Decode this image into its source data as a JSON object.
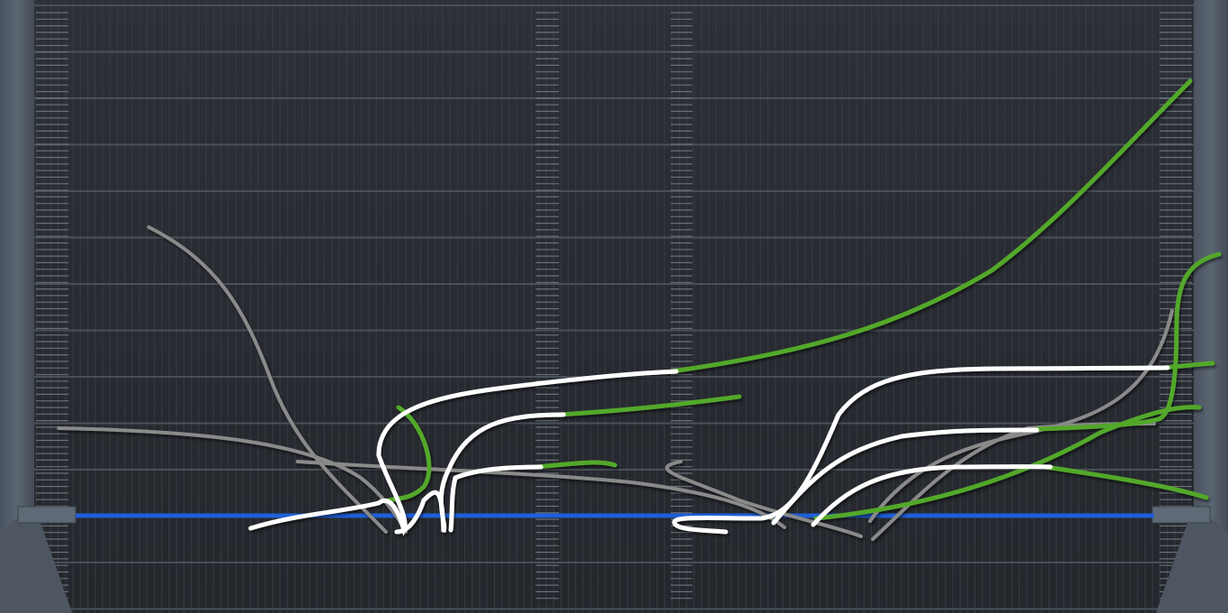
{
  "colors": {
    "background": "#26292f",
    "grid_panel": "#2b2f36",
    "grid_line_major": "#4a5058",
    "grid_line_minor": "#363b43",
    "frame": "#55606d",
    "frame_dark": "#3e4650",
    "tick_marks": "#7a8088",
    "blue_line": "#1f5fd8",
    "curve_gray": "#8a8a8a",
    "curve_white": "#ffffff",
    "curve_green": "#52a82a"
  },
  "icons": [
    "left-rail-handle-icon",
    "right-rail-handle-icon"
  ]
}
